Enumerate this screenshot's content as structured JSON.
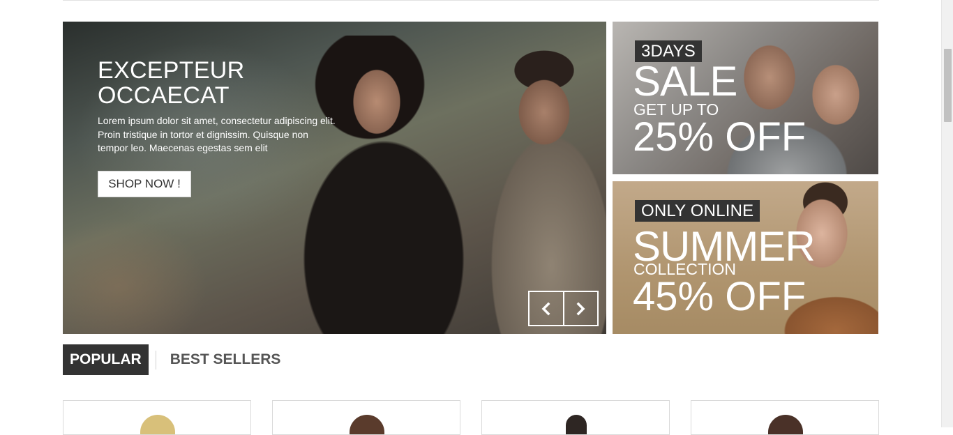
{
  "hero": {
    "title": "EXCEPTEUR\nOCCAECAT",
    "text": "Lorem ipsum dolor sit amet, consectetur adipiscing elit. Proin tristique in tortor et dignissim. Quisque non tempor leo. Maecenas egestas sem elit",
    "button_label": "SHOP NOW !",
    "prev_icon": "chevron-left-icon",
    "next_icon": "chevron-right-icon"
  },
  "promos": [
    {
      "tag": "3DAYS",
      "headline": "SALE",
      "subline": "GET UP TO",
      "offer": "25% OFF"
    },
    {
      "tag": "ONLY ONLINE",
      "headline": "SUMMER",
      "subline": "COLLECTION",
      "offer": "45% OFF"
    }
  ],
  "tabs": [
    {
      "label": "POPULAR",
      "active": true
    },
    {
      "label": "BEST SELLERS",
      "active": false
    }
  ],
  "colors": {
    "tag_bg": "#333333",
    "tab_active_bg": "#333333",
    "tab_inactive_text": "#555555"
  }
}
